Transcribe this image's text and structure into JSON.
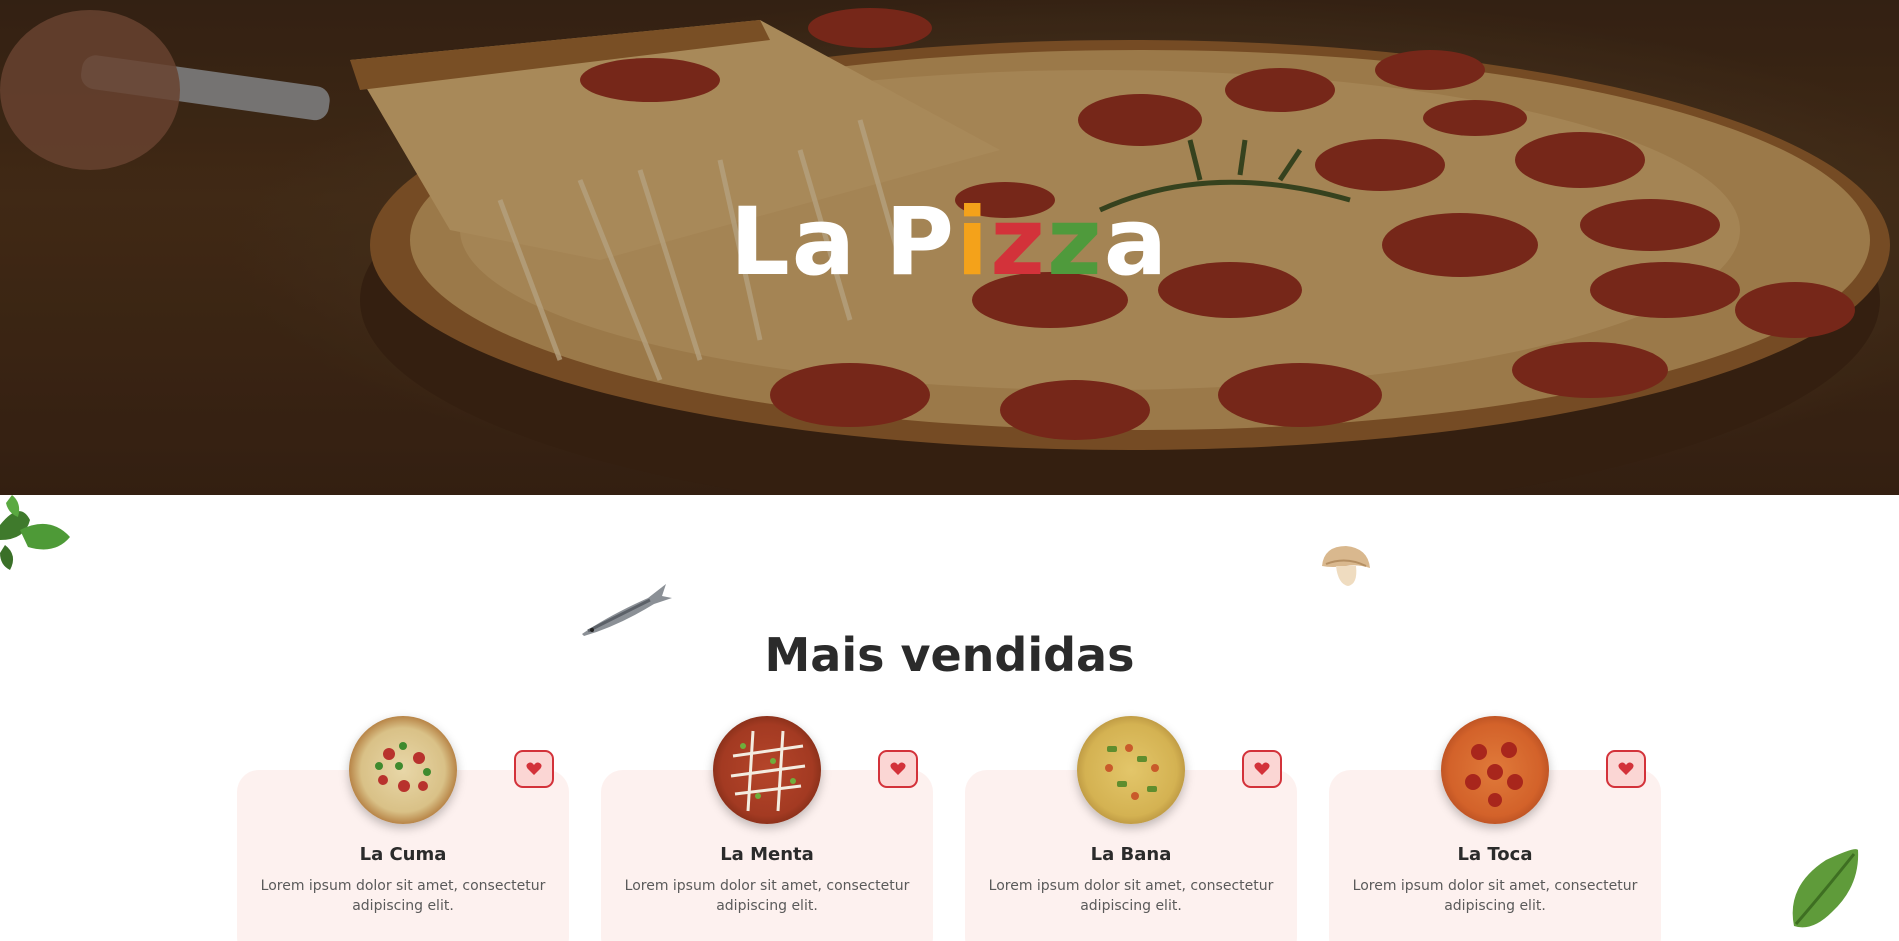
{
  "hero": {
    "title_letters": [
      {
        "ch": "L",
        "color": "#ffffff"
      },
      {
        "ch": "a",
        "color": "#ffffff"
      },
      {
        "ch": " ",
        "color": "#ffffff"
      },
      {
        "ch": "P",
        "color": "#ffffff"
      },
      {
        "ch": "i",
        "color": "#f4a21a"
      },
      {
        "ch": "z",
        "color": "#d3323a"
      },
      {
        "ch": "z",
        "color": "#4f9a3c"
      },
      {
        "ch": "a",
        "color": "#ffffff"
      }
    ]
  },
  "section": {
    "title": "Mais vendidas"
  },
  "products": [
    {
      "name": "La Cuma",
      "description": "Lorem ipsum dolor sit amet, consectetur adipiscing elit.",
      "fav_icon": "heart-icon"
    },
    {
      "name": "La Menta",
      "description": "Lorem ipsum dolor sit amet, consectetur adipiscing elit.",
      "fav_icon": "heart-icon"
    },
    {
      "name": "La Bana",
      "description": "Lorem ipsum dolor sit amet, consectetur adipiscing elit.",
      "fav_icon": "heart-icon"
    },
    {
      "name": "La Toca",
      "description": "Lorem ipsum dolor sit amet, consectetur adipiscing elit.",
      "fav_icon": "heart-icon"
    }
  ],
  "colors": {
    "accent_red": "#d3323a",
    "accent_orange": "#f4a21a",
    "accent_green": "#4f9a3c",
    "card_bg": "#fdf1ef",
    "fav_bg": "#fbd6d4"
  }
}
